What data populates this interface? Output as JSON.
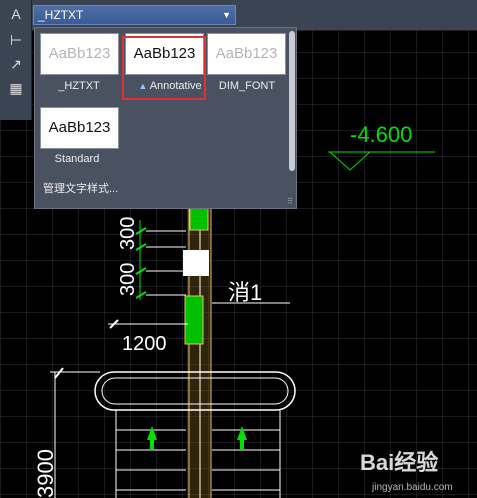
{
  "toolbar": {
    "style_combo_value": "_HZTXT",
    "combo_arrow": "▼"
  },
  "tools": [
    "text-style-icon",
    "dimension-icon",
    "leader-icon",
    "table-icon"
  ],
  "text_style_panel": {
    "preview_text": "AaBb123",
    "styles": [
      {
        "name": "_HZTXT",
        "annotative": false,
        "highlighted": false
      },
      {
        "name": "Annotative",
        "annotative": true,
        "highlighted": true
      },
      {
        "name": "DIM_FONT",
        "annotative": false,
        "highlighted": false
      },
      {
        "name": "Standard",
        "annotative": false,
        "highlighted": false
      }
    ],
    "manage_label": "管理文字样式..."
  },
  "drawing": {
    "elevation_label": "-4.600",
    "dims": [
      "300",
      "300",
      "1200",
      "3900"
    ],
    "room_label": "消1"
  },
  "watermark": {
    "brand": "Bai经验",
    "url": "jingyan.baidu.com"
  },
  "colors": {
    "accent_green": "#00e000",
    "highlight_red": "#e03030",
    "arrow_red": "#e84545"
  }
}
